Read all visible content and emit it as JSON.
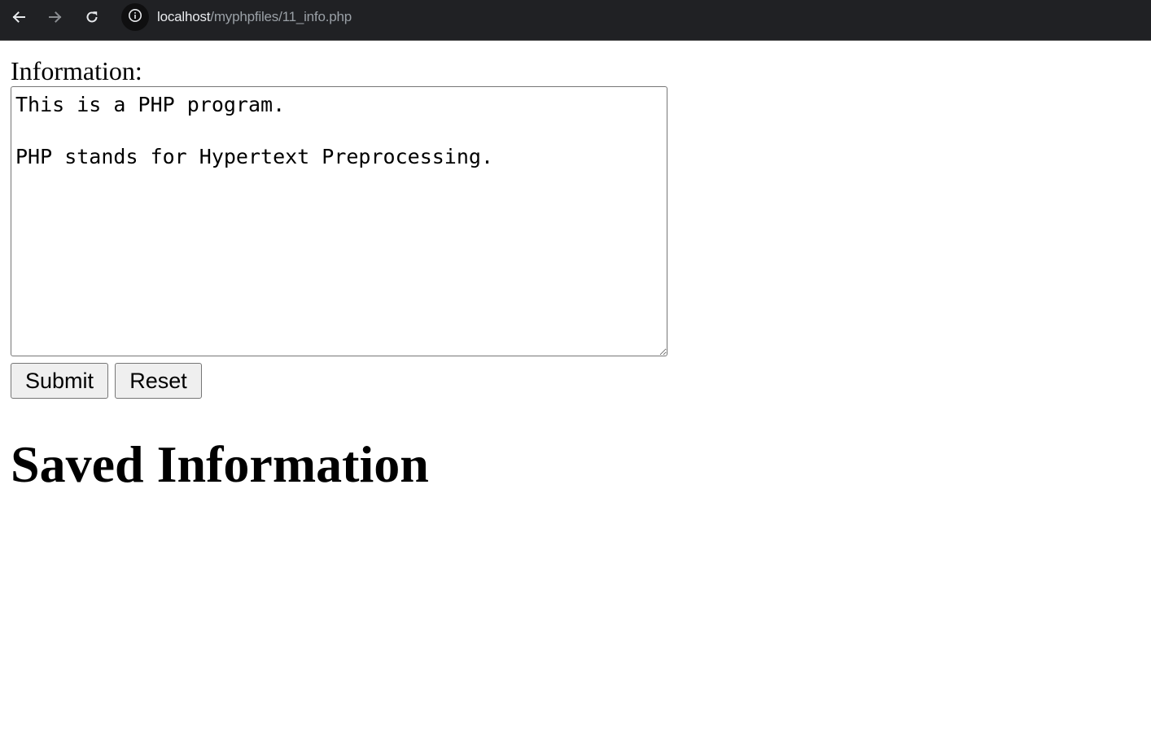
{
  "browser": {
    "url_host": "localhost",
    "url_path": "/myphpfiles/11_info.php",
    "nav": {
      "back_icon": "arrow-left-icon",
      "forward_icon": "arrow-right-icon",
      "reload_icon": "reload-icon",
      "site_info_icon": "info-circle-icon"
    },
    "colors": {
      "toolbar_bg": "#202124",
      "url_host": "#e8eaed",
      "url_path": "#9aa0a6"
    }
  },
  "form": {
    "label": "Information:",
    "textarea_value": "This is a PHP program.\n\nPHP stands for Hypertext Preprocessing.",
    "submit_label": "Submit",
    "reset_label": "Reset"
  },
  "saved": {
    "heading": "Saved Information"
  }
}
